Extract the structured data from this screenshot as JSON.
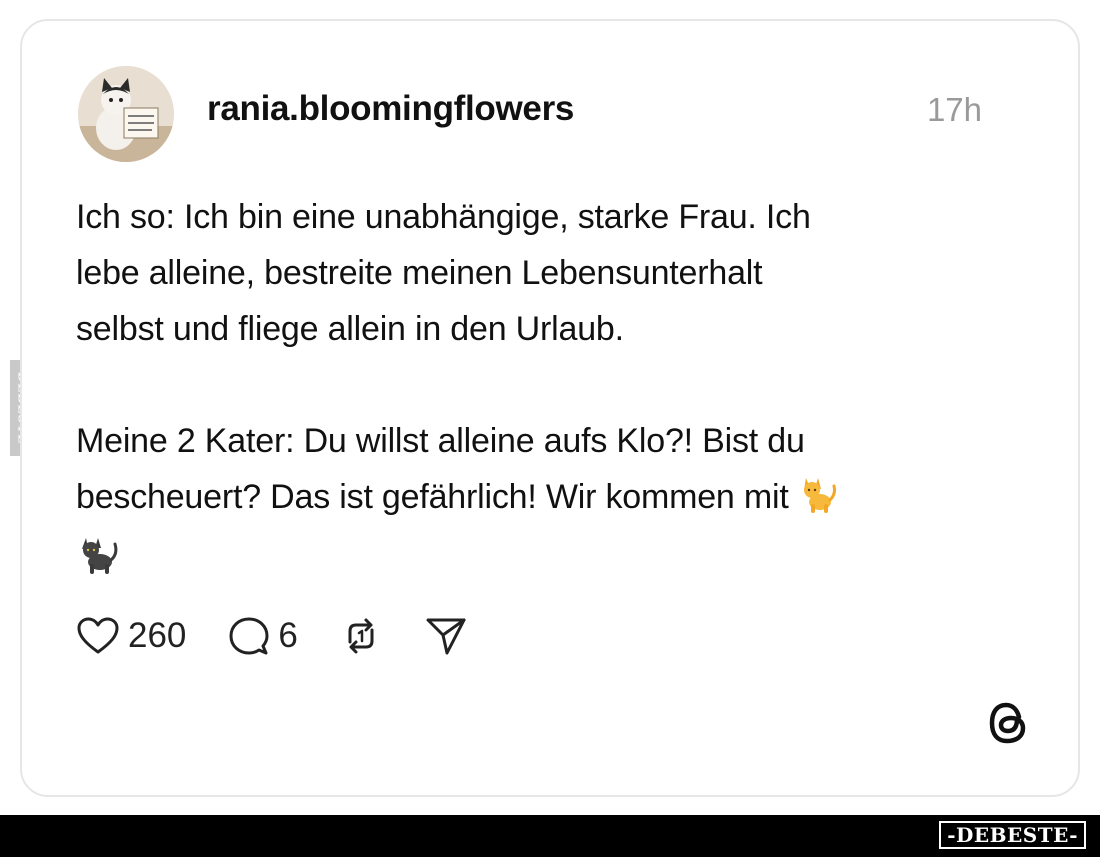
{
  "post": {
    "username": "rania.bloomingflowers",
    "timestamp": "17h",
    "avatar_sign_text": "ACH DU HEILIGE SCHEISSE!",
    "paragraph_1": "Ich so: Ich bin eine unabhängige, starke Frau. Ich\nlebe alleine, bestreite meinen Lebensunterhalt\nselbst und fliege allein in den Urlaub.",
    "paragraph_2": "Meine 2 Kater: Du willst alleine aufs Klo?! Bist du\nbescheuert? Das ist gefährlich! Wir kommen mit",
    "emojis": [
      "orange-cat-emoji",
      "black-cat-emoji"
    ]
  },
  "actions": {
    "like_count": "260",
    "comment_count": "6",
    "icons": [
      "heart-icon",
      "comment-icon",
      "repost-icon",
      "share-icon"
    ]
  },
  "branding": {
    "side_watermark": "DEBESTE",
    "footer_brand": "-DEBESTE-",
    "threads_icon": "threads-logo-icon"
  },
  "colors": {
    "text": "#111111",
    "muted": "#9a9a9a",
    "card_border": "#e6e6e6",
    "footer_bg": "#000000"
  }
}
